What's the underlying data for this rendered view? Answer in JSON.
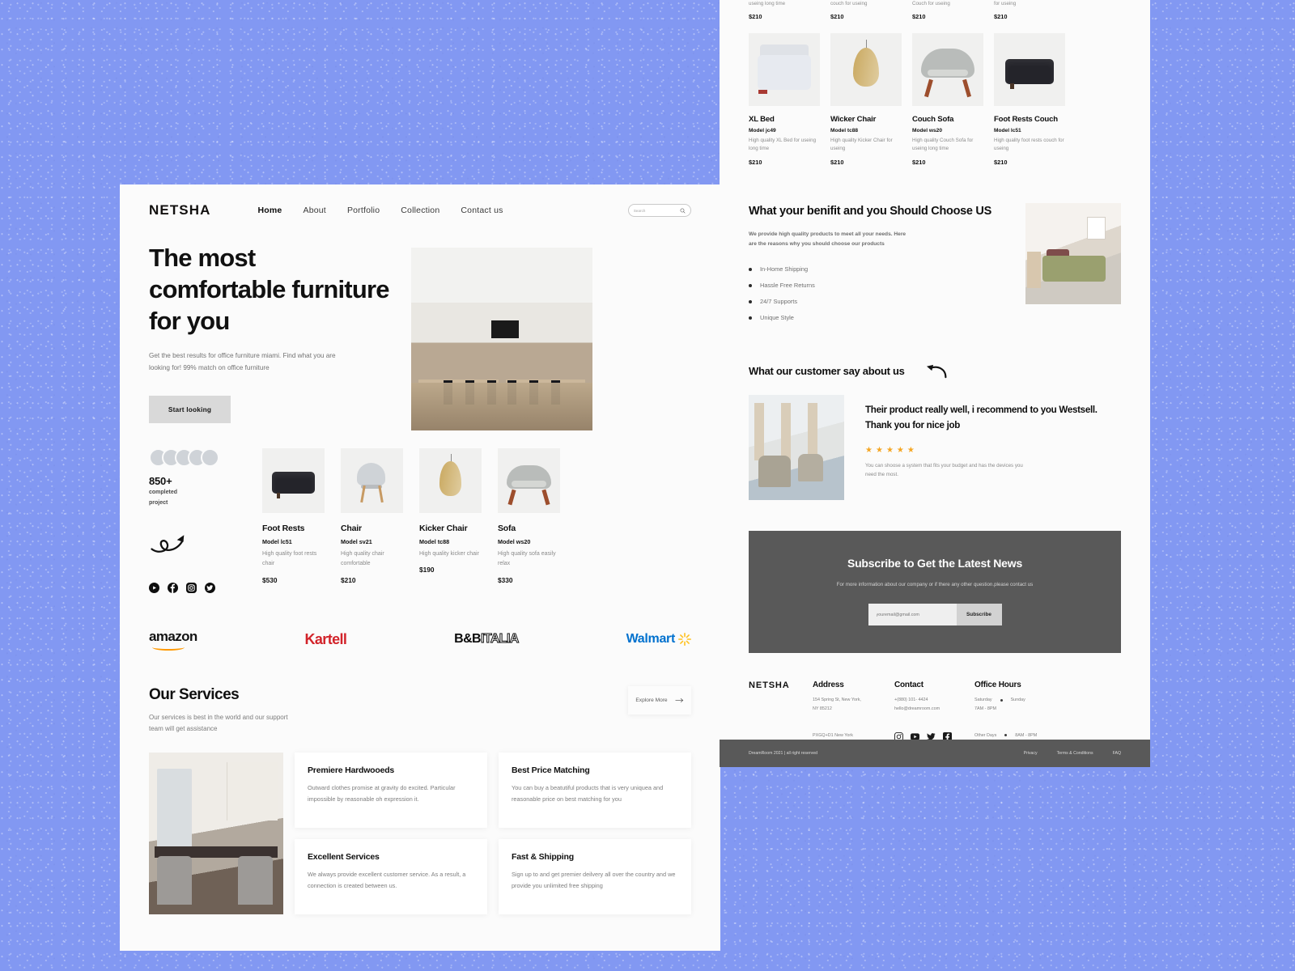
{
  "theme": {
    "page_bg": "#8298f2",
    "panel_bg": "#fbfbfb",
    "dark": "#595959",
    "accent_star": "#f5a623"
  },
  "header": {
    "brand": "NETSHA",
    "nav": [
      {
        "label": "Home",
        "active": true
      },
      {
        "label": "About",
        "active": false
      },
      {
        "label": "Portfolio",
        "active": false
      },
      {
        "label": "Collection",
        "active": false
      },
      {
        "label": "Contact  us",
        "active": false
      }
    ],
    "search": {
      "placeholder": "Search",
      "icon": "search-icon"
    }
  },
  "hero": {
    "title": "The most comfortable furniture for you",
    "subtitle": "Get the best results for office furniture miami. Find what you are looking for! 99% match on office furniture",
    "cta": "Start looking"
  },
  "stats": {
    "number": "850+",
    "label_line1": "completed",
    "label_line2": "project"
  },
  "socials": [
    "youtube-icon",
    "facebook-icon",
    "instagram-icon",
    "twitter-icon"
  ],
  "products": [
    {
      "name": "Foot Rests",
      "model": "Model lc51",
      "desc": "High quality foot rests chair",
      "price": "$530"
    },
    {
      "name": "Chair",
      "model": "Model sv21",
      "desc": "High quality chair comfortable",
      "price": "$210"
    },
    {
      "name": "Kicker Chair",
      "model": "Model tc88",
      "desc": "High quality kicker chair",
      "price": "$190"
    },
    {
      "name": "Sofa",
      "model": "Model ws20",
      "desc": "High quality sofa easily relax",
      "price": "$330"
    }
  ],
  "brands": [
    {
      "name": "amazon"
    },
    {
      "name": "Kartell"
    },
    {
      "name": "B&B"
    },
    {
      "name": "ITALIA"
    },
    {
      "name": "Walmart"
    }
  ],
  "services": {
    "title": "Our Services",
    "subtitle": "Our services is best in the world and our support team will get assistance",
    "explore": "Explore More",
    "cards": [
      {
        "title": "Premiere Hardwooeds",
        "text": "Outward clothes promise at gravity do excited. Particular impossible by reasonable oh expression it."
      },
      {
        "title": "Best Price Matching",
        "text": "You can buy a beatutiful products that is very uniquea and reasonable price on best matching for you"
      },
      {
        "title": "Excellent Services",
        "text": " We always provide excellent customer service. As a result, a connection is created between us."
      },
      {
        "title": "Fast & Shipping",
        "text": "Sign up to and get premier deilvery all over the country and we provide you unlimited free shipping"
      }
    ]
  },
  "right_top_partial": [
    {
      "desc": "useing long time",
      "price": "$210"
    },
    {
      "desc": "couch for useing",
      "price": "$210"
    },
    {
      "desc": "Couch for useing",
      "price": "$210"
    },
    {
      "desc": "for useing",
      "price": "$210"
    }
  ],
  "right_products": [
    {
      "name": "XL Bed",
      "model": "Model jc49",
      "desc": "High quality XL Bed for useing long time",
      "price": "$210"
    },
    {
      "name": "Wicker Chair",
      "model": "Model tc88",
      "desc": "High quality Kicker Chair for useing",
      "price": "$210"
    },
    {
      "name": "Couch Sofa",
      "model": "Model ws20",
      "desc": "High quality Couch Sofa for useing long time",
      "price": "$210"
    },
    {
      "name": "Foot Rests Couch",
      "model": "Model lc51",
      "desc": "High quality foot rests couch for useing",
      "price": "$210"
    }
  ],
  "benefit": {
    "title": "What your benifit and you Should Choose US",
    "subtitle": "We provide high quality products to meet all your needs. Here are the reasons why you should choose our products",
    "items": [
      "In-Home Shipping",
      "Hassle Free Returns",
      "24/7 Supports",
      "Unique Style"
    ]
  },
  "testimonial": {
    "heading": "What our customer say about us",
    "quote": "Their product really well, i recommend  to you Westsell. Thank you for nice job",
    "stars": 5,
    "meta": "You can shoose a system that fits your budget and has the devices you need the most."
  },
  "subscribe": {
    "title": "Subscribe to Get the Latest News",
    "text": "For more information about our company or if there any other question.please contact us",
    "email_placeholder": "youremail@gmail.com",
    "button": "Subscribe"
  },
  "footer": {
    "brand": "NETSHA",
    "address": {
      "heading": "Address",
      "line1": "154 Spring St, New York,",
      "line2": "NY 85212",
      "note": "PXGQ+D1  New York"
    },
    "contact": {
      "heading": "Contact",
      "phone": "+(880) 101- 4424",
      "email": "hello@dreamroom.com",
      "socials": [
        "instagram-icon",
        "youtube-icon",
        "twitter-icon",
        "facebook-icon"
      ]
    },
    "hours": {
      "heading": "Office Hours",
      "d1": "Saturday",
      "d2": "Sunday",
      "t1": "7AM - 8PM",
      "other_label": "Other Days",
      "other_time": "8AM - 8PM"
    },
    "bottom": {
      "copy": "DreamRoom 2021  | all right reserved",
      "links": [
        "Privacy",
        "Terms & Conditions",
        "FAQ"
      ]
    }
  }
}
